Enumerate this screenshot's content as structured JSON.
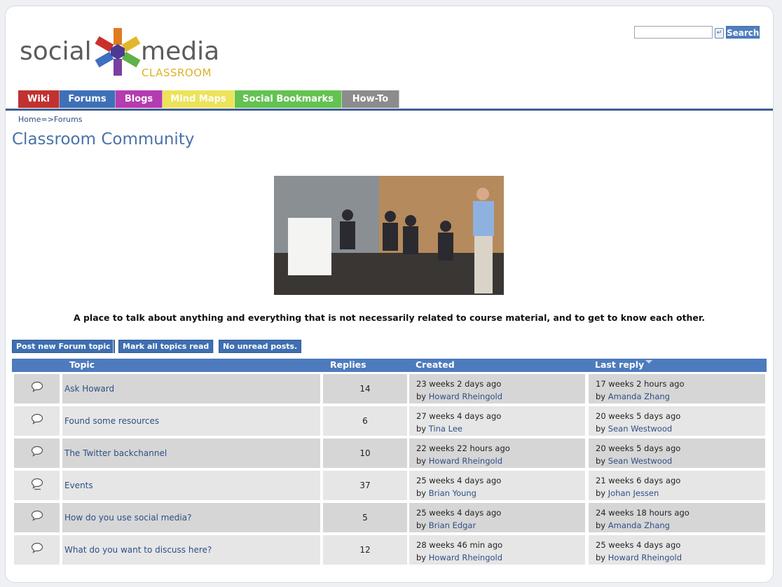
{
  "site": {
    "logo_word_1": "social",
    "logo_word_2": "media",
    "logo_sub": "CLASSROOM"
  },
  "search": {
    "value": "",
    "button_label": "Search"
  },
  "nav": {
    "tabs": [
      {
        "label": "Wiki",
        "color": "#c0322f"
      },
      {
        "label": "Forums",
        "color": "#3e70b8"
      },
      {
        "label": "Blogs",
        "color": "#b53bb0"
      },
      {
        "label": "Mind Maps",
        "color": "#ece35a"
      },
      {
        "label": "Social Bookmarks",
        "color": "#63c251"
      },
      {
        "label": "How-To",
        "color": "#8c8c8c"
      }
    ]
  },
  "breadcrumb": "Home=>Forums",
  "page_title": "Classroom Community",
  "tagline": "A place to talk about anything and everything that is not necessarily related to course material, and to get to know each other.",
  "actions": {
    "post_new": "Post new Forum topic",
    "mark_read": "Mark all topics read",
    "no_unread": "No unread posts."
  },
  "table": {
    "headers": {
      "topic": "Topic",
      "replies": "Replies",
      "created": "Created",
      "last_reply": "Last reply"
    },
    "rows": [
      {
        "topic": "Ask Howard",
        "replies": "14",
        "created_time": "23 weeks 2 days ago",
        "created_by": "by ",
        "created_user": "Howard Rheingold",
        "last_time": "17 weeks 2 hours ago",
        "last_by": "by ",
        "last_user": "Amanda Zhang"
      },
      {
        "topic": "Found some resources",
        "replies": "6",
        "created_time": "27 weeks 4 days ago",
        "created_by": "by ",
        "created_user": "Tina Lee",
        "last_time": "20 weeks 5 days ago",
        "last_by": "by ",
        "last_user": "Sean Westwood"
      },
      {
        "topic": "The Twitter backchannel",
        "replies": "10",
        "created_time": "22 weeks 22 hours ago",
        "created_by": "by ",
        "created_user": "Howard Rheingold",
        "last_time": "20 weeks 5 days ago",
        "last_by": "by ",
        "last_user": "Sean Westwood"
      },
      {
        "topic": "Events",
        "replies": "37",
        "created_time": "25 weeks 4 days ago",
        "created_by": "by ",
        "created_user": "Brian Young",
        "last_time": "21 weeks 6 days ago",
        "last_by": "by ",
        "last_user": "Johan Jessen"
      },
      {
        "topic": "How do you use social media?",
        "replies": "5",
        "created_time": "25 weeks 4 days ago",
        "created_by": "by ",
        "created_user": "Brian Edgar",
        "last_time": "24 weeks 18 hours ago",
        "last_by": "by ",
        "last_user": "Amanda Zhang"
      },
      {
        "topic": "What do you want to discuss here?",
        "replies": "12",
        "created_time": "28 weeks 46 min ago",
        "created_by": "by ",
        "created_user": "Howard Rheingold",
        "last_time": "25 weeks 4 days ago",
        "last_by": "by ",
        "last_user": "Howard Rheingold"
      }
    ]
  }
}
